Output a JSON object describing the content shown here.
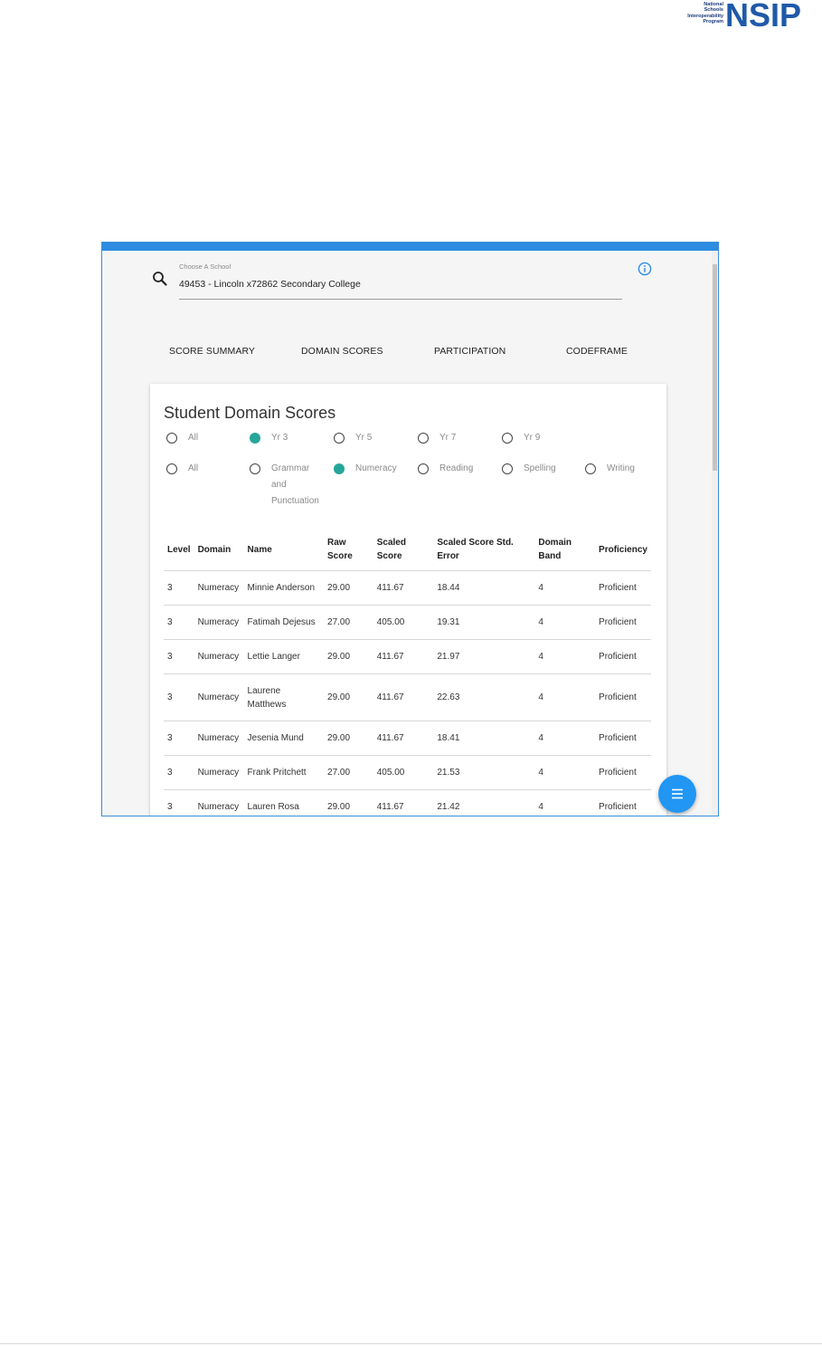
{
  "logo": {
    "small_lines": [
      "National",
      "Schools",
      "Interoperability",
      "Program"
    ],
    "big_text": "NSIP",
    "brand_color": "#1f5aa8"
  },
  "school": {
    "label": "Choose A School",
    "value": "49453 - Lincoln x72862 Secondary College"
  },
  "tabs": [
    "SCORE SUMMARY",
    "DOMAIN SCORES",
    "PARTICIPATION",
    "CODEFRAME"
  ],
  "card": {
    "title": "Student Domain Scores",
    "year_filters": [
      {
        "label": "All",
        "checked": false
      },
      {
        "label": "Yr 3",
        "checked": true
      },
      {
        "label": "Yr 5",
        "checked": false
      },
      {
        "label": "Yr 7",
        "checked": false
      },
      {
        "label": "Yr 9",
        "checked": false
      }
    ],
    "domain_filters": [
      {
        "label": "All",
        "checked": false
      },
      {
        "label": "Grammar and Punctuation",
        "label_lines": [
          "Grammar",
          "and",
          "Punctuation"
        ],
        "checked": false
      },
      {
        "label": "Numeracy",
        "checked": true
      },
      {
        "label": "Reading",
        "checked": false
      },
      {
        "label": "Spelling",
        "checked": false
      },
      {
        "label": "Writing",
        "checked": false
      }
    ],
    "accent_color": "#26a69a"
  },
  "table": {
    "headers": [
      "Level",
      "Domain",
      "Name",
      "Raw Score",
      "Scaled Score",
      "Scaled Score Std. Error",
      "Domain Band",
      "Proficiency"
    ],
    "rows": [
      [
        "3",
        "Numeracy",
        "Minnie Anderson",
        "29.00",
        "411.67",
        "18.44",
        "4",
        "Proficient"
      ],
      [
        "3",
        "Numeracy",
        "Fatimah Dejesus",
        "27.00",
        "405.00",
        "19.31",
        "4",
        "Proficient"
      ],
      [
        "3",
        "Numeracy",
        "Lettie Langer",
        "29.00",
        "411.67",
        "21.97",
        "4",
        "Proficient"
      ],
      [
        "3",
        "Numeracy",
        "Laurene Matthews",
        "29.00",
        "411.67",
        "22.63",
        "4",
        "Proficient"
      ],
      [
        "3",
        "Numeracy",
        "Jesenia Mund",
        "29.00",
        "411.67",
        "18.41",
        "4",
        "Proficient"
      ],
      [
        "3",
        "Numeracy",
        "Frank Pritchett",
        "27.00",
        "405.00",
        "21.53",
        "4",
        "Proficient"
      ],
      [
        "3",
        "Numeracy",
        "Lauren Rosa",
        "29.00",
        "411.67",
        "21.42",
        "4",
        "Proficient"
      ]
    ]
  },
  "fab": {
    "icon": "menu-lines-icon",
    "color": "#2196f3"
  },
  "topbar_color": "#2d8ce0"
}
